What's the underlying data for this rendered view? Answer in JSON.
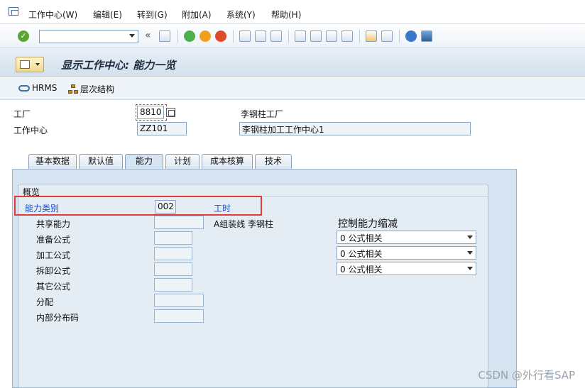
{
  "menu": {
    "items": [
      "工作中心(W)",
      "编辑(E)",
      "转到(G)",
      "附加(A)",
      "系统(Y)",
      "帮助(H)"
    ]
  },
  "toolbar": {
    "command_value": "",
    "back_glyph": "«"
  },
  "header": {
    "title": "显示工作中心: 能力一览"
  },
  "app_toolbar": {
    "hrms_label": "HRMS",
    "hierarchy_label": "层次结构"
  },
  "form": {
    "plant_label": "工厂",
    "plant_value": "8810",
    "plant_desc": "李钢柱工厂",
    "workcenter_label": "工作中心",
    "workcenter_value": "ZZ101",
    "workcenter_desc": "李钢柱加工工作中心1"
  },
  "tabs": [
    "基本数据",
    "默认值",
    "能力",
    "计划",
    "成本核算",
    "技术"
  ],
  "active_tab": "能力",
  "overview": {
    "group_title": "概览",
    "capacity_category_label": "能力类别",
    "capacity_category_value": "002",
    "capacity_category_text": "工时",
    "pooled_capacity_label": "共享能力",
    "pooled_capacity_text": "A组装线 李钢柱",
    "setup_formula_label": "准备公式",
    "processing_formula_label": "加工公式",
    "teardown_formula_label": "拆卸公式",
    "other_formula_label": "其它公式",
    "distribution_label": "分配",
    "internal_distribution_label": "内部分布码",
    "control_title": "控制能力缩减",
    "control_options": [
      "0 公式相关",
      "0 公式相关",
      "0 公式相关"
    ]
  },
  "watermark": "CSDN @外行看SAP",
  "colors": {
    "highlight_box": "#e23b3b",
    "link_blue": "#1f4fbf"
  }
}
